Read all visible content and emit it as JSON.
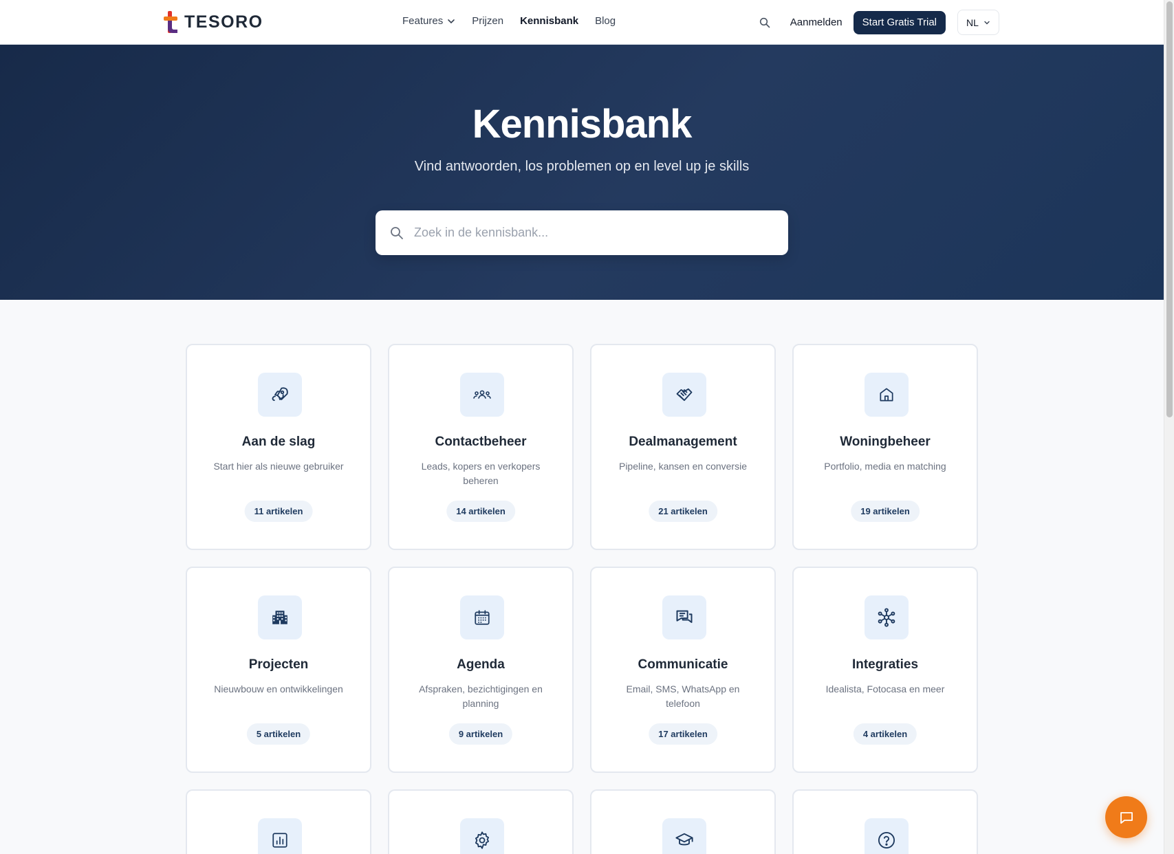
{
  "header": {
    "brand": "TESORO",
    "nav": [
      {
        "label": "Features",
        "dropdown": true
      },
      {
        "label": "Prijzen"
      },
      {
        "label": "Kennisbank",
        "active": true
      },
      {
        "label": "Blog"
      }
    ],
    "login_label": "Aanmelden",
    "trial_label": "Start Gratis Trial",
    "language": "NL"
  },
  "hero": {
    "title": "Kennisbank",
    "subtitle": "Vind antwoorden, los problemen op en level up je skills",
    "search_placeholder": "Zoek in de kennisbank..."
  },
  "categories": [
    {
      "icon": "rocket-icon",
      "title": "Aan de slag",
      "description": "Start hier als nieuwe gebruiker",
      "count": "11 artikelen"
    },
    {
      "icon": "users-icon",
      "title": "Contactbeheer",
      "description": "Leads, kopers en verkopers beheren",
      "count": "14 artikelen"
    },
    {
      "icon": "handshake-icon",
      "title": "Dealmanagement",
      "description": "Pipeline, kansen en conversie",
      "count": "21 artikelen"
    },
    {
      "icon": "home-icon",
      "title": "Woningbeheer",
      "description": "Portfolio, media en matching",
      "count": "19 artikelen"
    },
    {
      "icon": "building-icon",
      "title": "Projecten",
      "description": "Nieuwbouw en ontwikkelingen",
      "count": "5 artikelen"
    },
    {
      "icon": "calendar-icon",
      "title": "Agenda",
      "description": "Afspraken, bezichtigingen en planning",
      "count": "9 artikelen"
    },
    {
      "icon": "chat-bubbles-icon",
      "title": "Communicatie",
      "description": "Email, SMS, WhatsApp en telefoon",
      "count": "17 artikelen"
    },
    {
      "icon": "network-icon",
      "title": "Integraties",
      "description": "Idealista, Fotocasa en meer",
      "count": "4 artikelen"
    }
  ],
  "partial_categories": [
    {
      "icon": "bar-chart-icon"
    },
    {
      "icon": "gear-icon"
    },
    {
      "icon": "graduation-cap-icon"
    },
    {
      "icon": "help-circle-icon"
    }
  ],
  "colors": {
    "hero_bg": "#1c3156",
    "primary_button": "#152a4a",
    "chat_button": "#f07b19",
    "icon_tile": "#e7f0fb",
    "icon_stroke": "#1e3a5f"
  }
}
